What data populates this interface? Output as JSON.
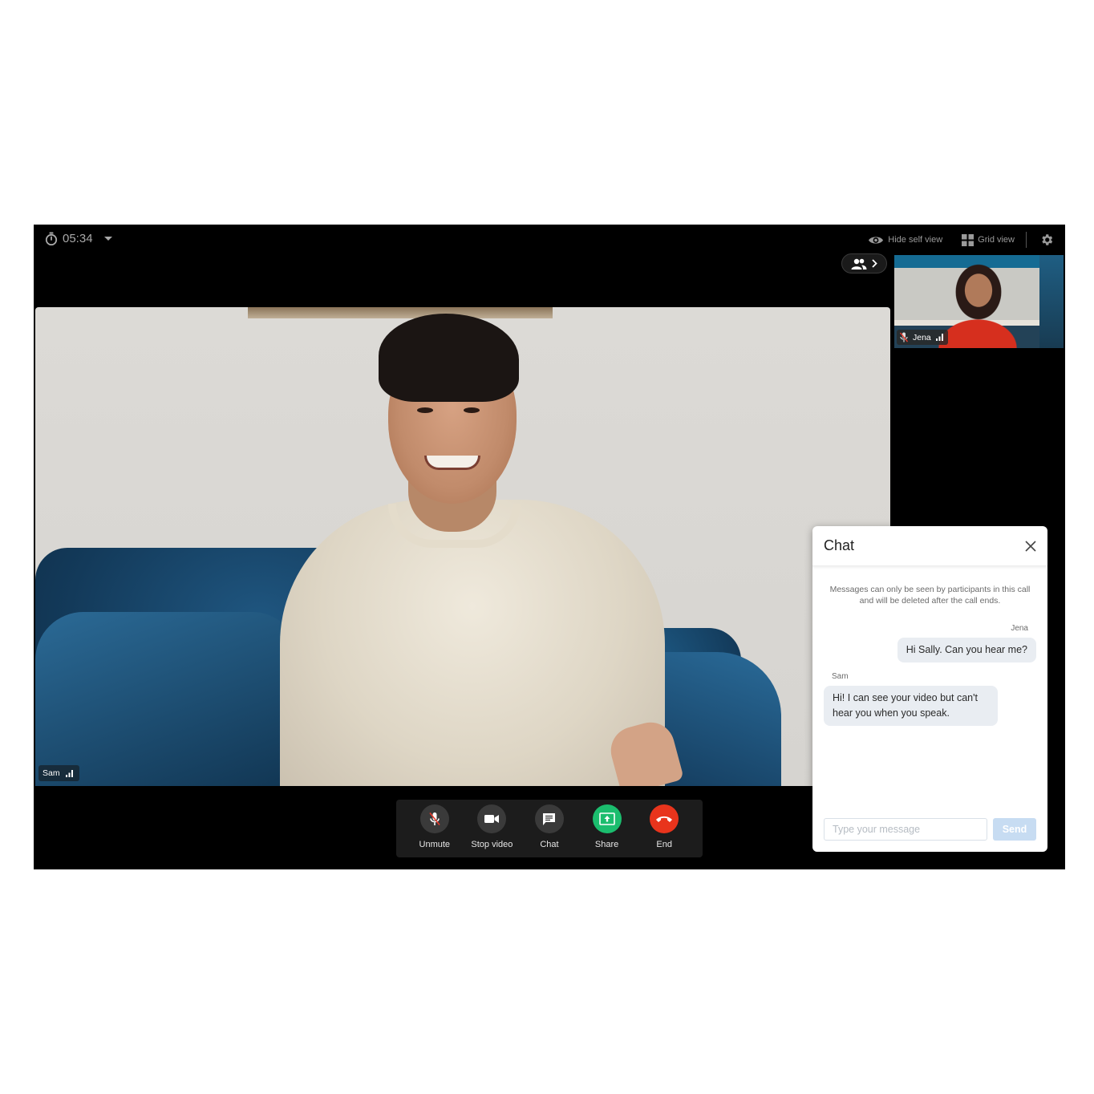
{
  "topbar": {
    "timer": "05:34",
    "hide_self_view_label": "Hide self view",
    "grid_view_label": "Grid view"
  },
  "participants_button": {
    "icon": "people-icon",
    "chevron": "chevron-right-icon"
  },
  "self_view": {
    "name": "Jena",
    "muted": true,
    "signal": "strong"
  },
  "main_video": {
    "name": "Sam",
    "signal": "strong"
  },
  "controls": [
    {
      "id": "unmute",
      "label": "Unmute",
      "icon": "mic-off-icon"
    },
    {
      "id": "stop-video",
      "label": "Stop video",
      "icon": "video-camera-icon"
    },
    {
      "id": "chat",
      "label": "Chat",
      "icon": "chat-icon"
    },
    {
      "id": "share",
      "label": "Share",
      "icon": "share-screen-icon"
    },
    {
      "id": "end",
      "label": "End",
      "icon": "hang-up-icon"
    }
  ],
  "colors": {
    "share": "#1bbd6e",
    "end": "#e8341c",
    "send_disabled": "#c7dcf2"
  },
  "chat": {
    "title": "Chat",
    "notice": "Messages can only be seen by participants in this call and will be deleted after the call ends.",
    "messages": [
      {
        "sender": "Jena",
        "text": "Hi Sally. Can you hear me?",
        "align": "right"
      },
      {
        "sender": "Sam",
        "text": "Hi! I can see your video but can't hear you when you speak.",
        "align": "left"
      }
    ],
    "input_placeholder": "Type your message",
    "input_value": "",
    "send_label": "Send"
  }
}
